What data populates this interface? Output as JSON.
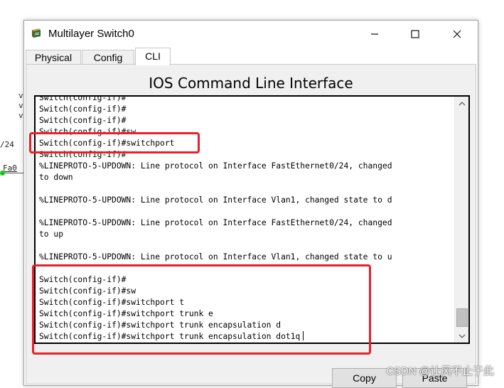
{
  "window": {
    "title": "Multilayer Switch0"
  },
  "tabs": [
    {
      "label": "Physical",
      "active": false
    },
    {
      "label": "Config",
      "active": false
    },
    {
      "label": "CLI",
      "active": true
    }
  ],
  "panel": {
    "title": "IOS Command Line Interface"
  },
  "terminal": {
    "lines": [
      "Switch(config-if)#",
      "Switch(config-if)#",
      "Switch(config-if)#",
      "Switch(config-if)#sw",
      "Switch(config-if)#switchport",
      "Switch(config-if)#",
      "%LINEPROTO-5-UPDOWN: Line protocol on Interface FastEthernet0/24, changed",
      "to down",
      "",
      "%LINEPROTO-5-UPDOWN: Line protocol on Interface Vlan1, changed state to d",
      "",
      "%LINEPROTO-5-UPDOWN: Line protocol on Interface FastEthernet0/24, changed",
      "to up",
      "",
      "%LINEPROTO-5-UPDOWN: Line protocol on Interface Vlan1, changed state to u",
      "",
      "Switch(config-if)#",
      "Switch(config-if)#sw",
      "Switch(config-if)#switchport t",
      "Switch(config-if)#switchport trunk e",
      "Switch(config-if)#switchport trunk encapsulation d",
      "Switch(config-if)#switchport trunk encapsulation dot1q"
    ]
  },
  "buttons": {
    "copy": "Copy",
    "paste": "Paste"
  },
  "background": {
    "fragment_24": "/24",
    "fragment_fa0": "Fa0"
  },
  "watermark": "CSDN @让风不止于此",
  "colors": {
    "highlight": "#e8202a",
    "link_dot": "#14c814"
  }
}
